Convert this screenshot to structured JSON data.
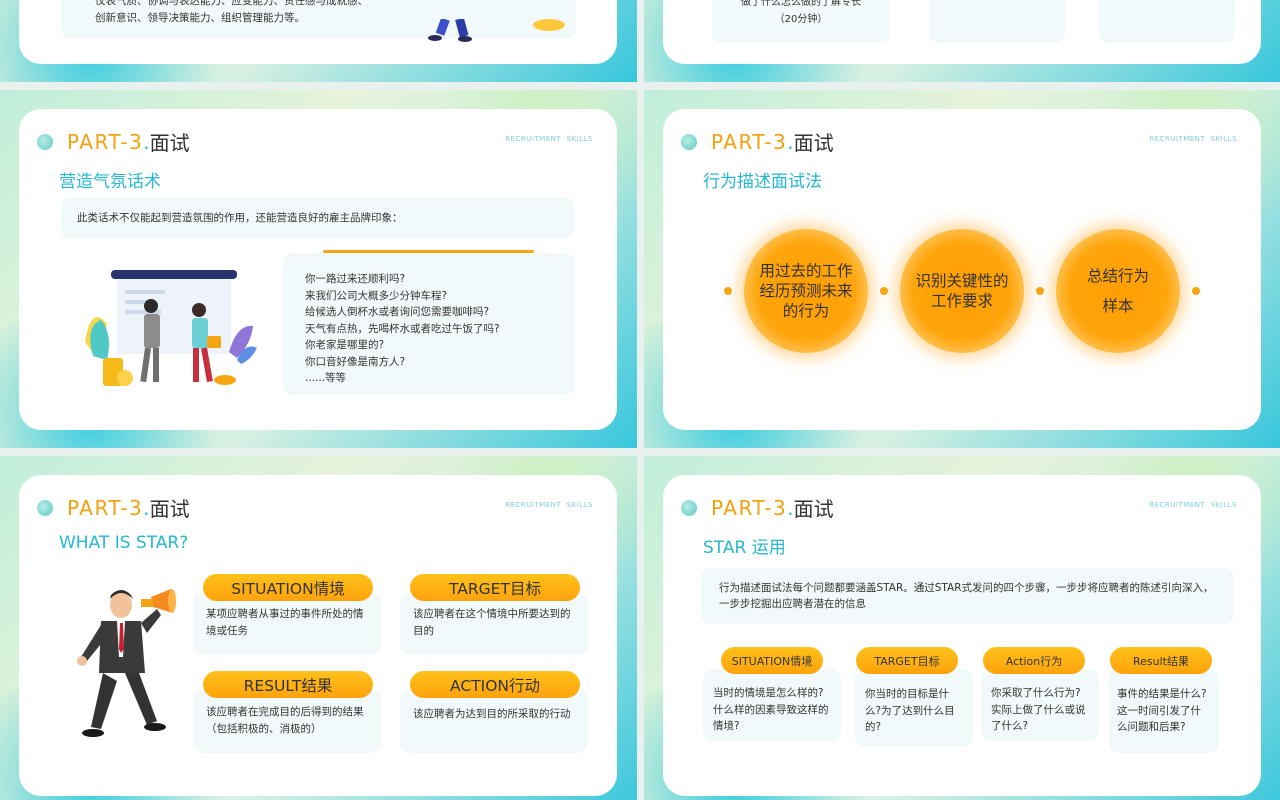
{
  "common": {
    "part_label": "PART-3",
    "part_dot": ".",
    "part_title": "面试",
    "tag_left": "RECRUITMENT",
    "tag_right": "SKILLS"
  },
  "slide_top_left": {
    "line1": "仪表气质、协调与表达能力、应变能力、责任感与成就感、",
    "line2": "创新意识、领导决策能力、组织管理能力等。"
  },
  "slide_top_right": {
    "line1": "做了什么怎么做的了解专长",
    "line2": "（20分钟）"
  },
  "slide_mid_left": {
    "subtitle": "营造气氛话术",
    "intro": "此类话术不仅能起到营造氛围的作用，还能营造良好的雇主品牌印象：",
    "questions": [
      "你一路过来还顺利吗?",
      "来我们公司大概多少分钟车程?",
      "给候选人倒杯水或者询问您需要咖啡吗?",
      "天气有点热，先喝杯水或者吃过午饭了吗?",
      "你老家是哪里的?",
      "你口音好像是南方人?",
      "......等等"
    ]
  },
  "slide_mid_right": {
    "subtitle": "行为描述面试法",
    "circles": [
      {
        "l1": "用过去的工作",
        "l2": "经历预测未来",
        "l3": "的行为"
      },
      {
        "l1": "识别关键性的",
        "l2": "工作要求",
        "l3": ""
      },
      {
        "l1": "总结行为",
        "l2": "样本",
        "l3": ""
      }
    ]
  },
  "slide_bot_left": {
    "subtitle": "WHAT IS STAR?",
    "items": [
      {
        "label": "SITUATION情境",
        "desc": "某项应聘者从事过的事件所处的情境或任务"
      },
      {
        "label": "TARGET目标",
        "desc": "该应聘者在这个情境中所要达到的目的"
      },
      {
        "label": "RESULT结果",
        "desc": "该应聘者在完成目的后得到的结果（包括积极的、消极的）"
      },
      {
        "label": "ACTION行动",
        "desc": "该应聘者为达到目的所采取的行动"
      }
    ]
  },
  "slide_bot_right": {
    "subtitle": "STAR 运用",
    "intro": "行为描述面试法每个问题都要涵盖STAR。通过STAR式发问的四个步骤，一步步将应聘者的陈述引向深入，一步步挖掘出应聘者潜在的信息",
    "items": [
      {
        "label": "SITUATION情境",
        "desc": "当时的情境是怎么样的?什么样的因素导致这样的情境?"
      },
      {
        "label": "TARGET目标",
        "desc": "你当时的目标是什么?为了达到什么目的?"
      },
      {
        "label": "Action行为",
        "desc": "你采取了什么行为? 实际上做了什么或说了什么?"
      },
      {
        "label": "Result结果",
        "desc": "事件的结果是什么?这一时间引发了什么问题和后果?"
      }
    ]
  },
  "colors": {
    "accent_orange": "#f2a10f",
    "accent_teal": "#26b7d1"
  }
}
